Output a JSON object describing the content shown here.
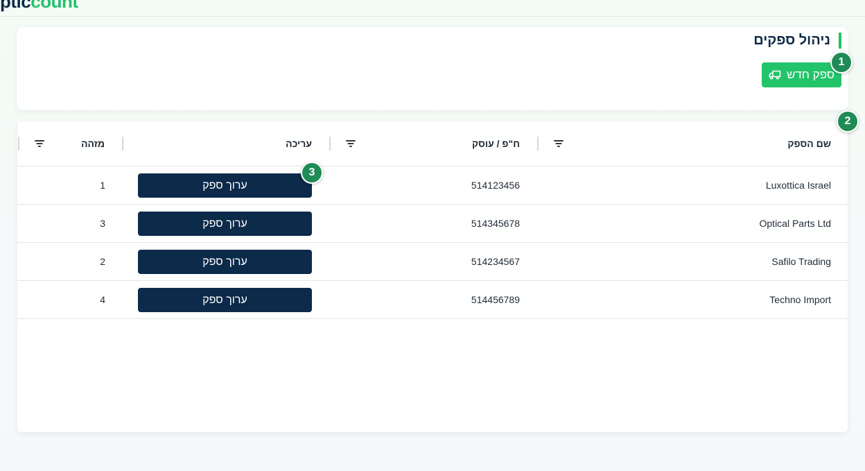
{
  "brand": {
    "part1": "ptic",
    "part2": "count"
  },
  "header": {
    "title": "ניהול ספקים",
    "new_supplier_label": "ספק חדש",
    "new_supplier_icon": "truck-icon"
  },
  "steps": [
    "1",
    "2",
    "3"
  ],
  "grid": {
    "columns": {
      "name": "שם הספק",
      "vat": "ח\"פ / עוסק",
      "edit": "עריכה",
      "id": "מזהה"
    },
    "rows": [
      {
        "name": "Luxottica Israel",
        "vat": "514123456",
        "edit_label": "ערוך ספק",
        "id": "1"
      },
      {
        "name": "Optical Parts Ltd",
        "vat": "514345678",
        "edit_label": "ערוך ספק",
        "id": "3"
      },
      {
        "name": "Safilo Trading",
        "vat": "514234567",
        "edit_label": "ערוך ספק",
        "id": "2"
      },
      {
        "name": "Techno Import",
        "vat": "514456789",
        "edit_label": "ערוך ספק",
        "id": "4"
      }
    ]
  },
  "colors": {
    "primary_green": "#22c46a",
    "badge_green": "#1f8b55",
    "navy": "#0c2a49"
  }
}
